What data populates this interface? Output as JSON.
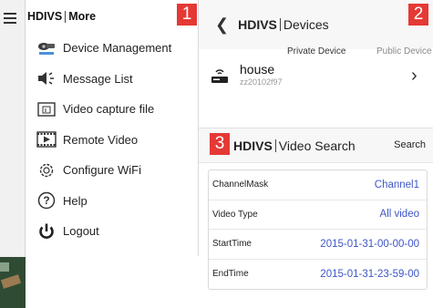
{
  "panel1": {
    "badge": "1",
    "brand": "HDIVS",
    "title": "More",
    "items": [
      {
        "label": "Device Management",
        "icon": "camera-icon"
      },
      {
        "label": "Message List",
        "icon": "speaker-icon"
      },
      {
        "label": "Video capture file",
        "icon": "file-icon"
      },
      {
        "label": "Remote Video",
        "icon": "film-icon"
      },
      {
        "label": "Configure WiFi",
        "icon": "gear-icon"
      },
      {
        "label": "Help",
        "icon": "help-icon"
      },
      {
        "label": "Logout",
        "icon": "power-icon"
      }
    ]
  },
  "panel2": {
    "badge": "2",
    "brand": "HDIVS",
    "title": "Devices",
    "tabs": [
      "Private Device",
      "Public Device"
    ],
    "device": {
      "name": "house",
      "id": "zz20102f97"
    }
  },
  "panel3": {
    "badge": "3",
    "brand": "HDIVS",
    "title": "Video Search",
    "search_label": "Search",
    "rows": [
      {
        "label": "ChannelMask",
        "value": "Channel1"
      },
      {
        "label": "Video Type",
        "value": "All video"
      },
      {
        "label": "StartTime",
        "value": "2015-01-31-00-00-00"
      },
      {
        "label": "EndTime",
        "value": "2015-01-31-23-59-00"
      }
    ]
  },
  "colors": {
    "badge": "#e53935",
    "value": "#3e55c8"
  }
}
